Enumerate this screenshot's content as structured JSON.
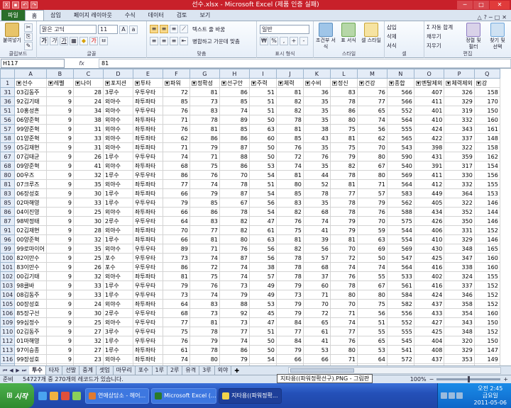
{
  "window": {
    "title": "선수.xlsx - Microsoft Excel (제품 인증 실패)",
    "min": "─",
    "max": "□",
    "close": "✕"
  },
  "ribbon_tabs": [
    "파일",
    "홈",
    "삽입",
    "페이지 레이아웃",
    "수식",
    "데이터",
    "검토",
    "보기"
  ],
  "ribbon": {
    "clipboard": {
      "paste": "붙여넣기",
      "label": "클립보드"
    },
    "font": {
      "name": "맑은 고딕",
      "size": "11",
      "label": "글꼴"
    },
    "alignment": {
      "wrap": "텍스트 줄 바꿈",
      "merge": "병합하고 가운데 맞춤",
      "label": "맞춤"
    },
    "number": {
      "format": "일반",
      "label": "표시 형식"
    },
    "styles": {
      "conditional": "조건부 서식",
      "table": "표 서식",
      "cell": "셀 스타일",
      "label": "스타일"
    },
    "cells": {
      "insert": "삽입",
      "delete": "삭제",
      "format": "서식",
      "label": "셀"
    },
    "editing": {
      "autosum": "자동 합계",
      "fill": "채우기",
      "clear": "지우기",
      "sort": "정렬 및 필터",
      "find": "찾기 및 선택",
      "label": "편집"
    }
  },
  "formula_bar": {
    "name_box": "H117",
    "fx": "fx",
    "value": "81"
  },
  "columns": [
    "A",
    "B",
    "C",
    "D",
    "E",
    "F",
    "G",
    "H",
    "I",
    "J",
    "K",
    "L",
    "M",
    "N",
    "O",
    "P",
    "Q"
  ],
  "header_row": {
    "row": "1",
    "cells": [
      "선수",
      "레벨",
      "나이",
      "포지션",
      "투타",
      "파워",
      "정확성",
      "선구안",
      "주력",
      "체력",
      "수비",
      "정신",
      "건강",
      "종합",
      "멘탈제외",
      "체력제외",
      "강"
    ]
  },
  "rows": [
    {
      "r": "31",
      "c": [
        "03김동주",
        "9",
        "28",
        "3루수",
        "우투우타",
        "72",
        "81",
        "86",
        "51",
        "81",
        "36",
        "83",
        "76",
        "566",
        "407",
        "326",
        "158"
      ]
    },
    {
      "r": "36",
      "c": [
        "92김기태",
        "9",
        "24",
        "외야수",
        "좌투좌타",
        "85",
        "73",
        "85",
        "51",
        "82",
        "35",
        "78",
        "77",
        "566",
        "411",
        "329",
        "170"
      ]
    },
    {
      "r": "51",
      "c": [
        "10홍성흔",
        "9",
        "34",
        "외야수",
        "우투우타",
        "76",
        "83",
        "74",
        "51",
        "82",
        "35",
        "86",
        "65",
        "552",
        "401",
        "319",
        "150"
      ]
    },
    {
      "r": "56",
      "c": [
        "06양준혁",
        "9",
        "38",
        "외야수",
        "좌투좌타",
        "71",
        "78",
        "89",
        "50",
        "78",
        "35",
        "80",
        "74",
        "564",
        "410",
        "332",
        "160"
      ]
    },
    {
      "r": "57",
      "c": [
        "99양준혁",
        "9",
        "31",
        "외야수",
        "좌투좌타",
        "76",
        "81",
        "85",
        "63",
        "81",
        "38",
        "75",
        "56",
        "555",
        "424",
        "343",
        "161"
      ]
    },
    {
      "r": "58",
      "c": [
        "01양준혁",
        "9",
        "33",
        "외야수",
        "좌투좌타",
        "62",
        "86",
        "86",
        "60",
        "85",
        "43",
        "81",
        "62",
        "565",
        "422",
        "337",
        "148"
      ]
    },
    {
      "r": "59",
      "c": [
        "05김재현",
        "9",
        "31",
        "외야수",
        "좌투좌타",
        "71",
        "79",
        "87",
        "50",
        "76",
        "35",
        "75",
        "70",
        "543",
        "398",
        "322",
        "158"
      ]
    },
    {
      "r": "67",
      "c": [
        "07김태균",
        "9",
        "26",
        "1루수",
        "우투우타",
        "74",
        "71",
        "88",
        "50",
        "72",
        "76",
        "79",
        "80",
        "590",
        "431",
        "359",
        "162"
      ]
    },
    {
      "r": "68",
      "c": [
        "09양준혁",
        "9",
        "41",
        "외야수",
        "좌투좌타",
        "68",
        "75",
        "86",
        "53",
        "74",
        "35",
        "82",
        "67",
        "540",
        "391",
        "317",
        "154"
      ]
    },
    {
      "r": "80",
      "c": [
        "00우즈",
        "9",
        "32",
        "1루수",
        "우투우타",
        "86",
        "76",
        "70",
        "54",
        "81",
        "44",
        "78",
        "80",
        "569",
        "411",
        "330",
        "156"
      ]
    },
    {
      "r": "81",
      "c": [
        "07크루즈",
        "9",
        "35",
        "외야수",
        "좌투좌타",
        "77",
        "74",
        "78",
        "51",
        "80",
        "52",
        "81",
        "71",
        "564",
        "412",
        "332",
        "155"
      ]
    },
    {
      "r": "83",
      "c": [
        "06장성호",
        "9",
        "30",
        "1루수",
        "좌투좌타",
        "66",
        "79",
        "87",
        "54",
        "85",
        "78",
        "77",
        "57",
        "583",
        "449",
        "364",
        "153"
      ]
    },
    {
      "r": "85",
      "c": [
        "02마해영",
        "9",
        "33",
        "1루수",
        "우투우타",
        "79",
        "85",
        "67",
        "56",
        "83",
        "35",
        "78",
        "79",
        "562",
        "405",
        "322",
        "146"
      ]
    },
    {
      "r": "86",
      "c": [
        "04이진영",
        "9",
        "25",
        "외야수",
        "좌투좌타",
        "66",
        "86",
        "78",
        "54",
        "82",
        "68",
        "78",
        "76",
        "588",
        "434",
        "352",
        "144"
      ]
    },
    {
      "r": "87",
      "c": [
        "98박정태",
        "9",
        "30",
        "2루수",
        "우투우타",
        "64",
        "83",
        "82",
        "47",
        "76",
        "74",
        "79",
        "70",
        "575",
        "426",
        "350",
        "146"
      ]
    },
    {
      "r": "91",
      "c": [
        "02김재현",
        "9",
        "28",
        "외야수",
        "좌투좌타",
        "70",
        "77",
        "82",
        "61",
        "75",
        "41",
        "79",
        "59",
        "544",
        "406",
        "331",
        "152"
      ]
    },
    {
      "r": "96",
      "c": [
        "00양준혁",
        "9",
        "32",
        "1루수",
        "좌투좌타",
        "66",
        "81",
        "80",
        "63",
        "81",
        "39",
        "81",
        "63",
        "554",
        "410",
        "329",
        "146"
      ]
    },
    {
      "r": "99",
      "c": [
        "99로마이어",
        "9",
        "35",
        "외야수",
        "우투우타",
        "89",
        "71",
        "76",
        "56",
        "82",
        "56",
        "70",
        "69",
        "569",
        "430",
        "348",
        "165"
      ]
    },
    {
      "r": "100",
      "c": [
        "82이만수",
        "9",
        "25",
        "포수",
        "우투우타",
        "73",
        "74",
        "87",
        "56",
        "78",
        "57",
        "72",
        "50",
        "547",
        "425",
        "347",
        "160"
      ]
    },
    {
      "r": "101",
      "c": [
        "83이만수",
        "9",
        "26",
        "포수",
        "우투우타",
        "86",
        "72",
        "74",
        "38",
        "78",
        "68",
        "74",
        "74",
        "564",
        "416",
        "338",
        "160"
      ]
    },
    {
      "r": "102",
      "c": [
        "00김기태",
        "9",
        "32",
        "외야수",
        "좌투좌타",
        "81",
        "75",
        "74",
        "57",
        "78",
        "37",
        "76",
        "55",
        "533",
        "402",
        "324",
        "155"
      ]
    },
    {
      "r": "103",
      "c": [
        "98클바",
        "9",
        "33",
        "1루수",
        "우투우타",
        "79",
        "76",
        "73",
        "49",
        "79",
        "60",
        "78",
        "67",
        "561",
        "416",
        "337",
        "152"
      ]
    },
    {
      "r": "104",
      "c": [
        "08김동주",
        "9",
        "33",
        "1루수",
        "우투우타",
        "73",
        "74",
        "79",
        "49",
        "73",
        "71",
        "80",
        "80",
        "584",
        "424",
        "346",
        "152"
      ]
    },
    {
      "r": "105",
      "c": [
        "00장성호",
        "9",
        "24",
        "외야수",
        "좌투좌타",
        "64",
        "83",
        "88",
        "53",
        "79",
        "70",
        "70",
        "75",
        "582",
        "437",
        "358",
        "152"
      ]
    },
    {
      "r": "106",
      "c": [
        "85장구선",
        "9",
        "30",
        "2루수",
        "우투우타",
        "68",
        "73",
        "92",
        "45",
        "79",
        "72",
        "71",
        "56",
        "556",
        "433",
        "354",
        "160"
      ]
    },
    {
      "r": "109",
      "c": [
        "99심정수",
        "9",
        "25",
        "외야수",
        "우투우타",
        "77",
        "81",
        "73",
        "47",
        "84",
        "65",
        "74",
        "51",
        "552",
        "427",
        "343",
        "150"
      ]
    },
    {
      "r": "110",
      "c": [
        "02김동주",
        "9",
        "27",
        "3루수",
        "우투우타",
        "75",
        "78",
        "77",
        "51",
        "77",
        "61",
        "77",
        "55",
        "555",
        "425",
        "348",
        "152"
      ]
    },
    {
      "r": "112",
      "c": [
        "01마해영",
        "9",
        "32",
        "1루수",
        "우투우타",
        "76",
        "79",
        "74",
        "50",
        "84",
        "41",
        "76",
        "65",
        "545",
        "404",
        "320",
        "150"
      ]
    },
    {
      "r": "113",
      "c": [
        "97이승종",
        "9",
        "27",
        "1루수",
        "좌투좌타",
        "61",
        "78",
        "86",
        "50",
        "79",
        "53",
        "80",
        "53",
        "541",
        "408",
        "329",
        "147"
      ]
    },
    {
      "r": "116",
      "c": [
        "99장성호",
        "9",
        "23",
        "외야수",
        "좌투좌타",
        "74",
        "80",
        "79",
        "54",
        "66",
        "66",
        "71",
        "64",
        "572",
        "437",
        "353",
        "149"
      ]
    },
    {
      "r": "117",
      "c": [
        "04장성호",
        "9",
        "28",
        "1루수",
        "좌투좌타",
        "69",
        "80",
        "81",
        "56",
        "78",
        "74",
        "63",
        "70",
        "570",
        "433",
        "354",
        "150"
      ]
    },
    {
      "r": "118",
      "c": [
        "03이호준",
        "9",
        "28",
        "1루수",
        "우투우타",
        "81",
        "74",
        "68",
        "51",
        "74",
        "41",
        "74",
        "74",
        "555",
        "407",
        "327",
        "156"
      ]
    }
  ],
  "sheet_tabs": [
    "투수",
    "타자",
    "선발",
    "중계",
    "셋업",
    "마무리",
    "포수",
    "1루",
    "2루",
    "유격",
    "3루",
    "외야"
  ],
  "active_sheet": "투수",
  "status": {
    "ready": "준비",
    "records": "54727개 중 270개의 레코드가 있습니다.",
    "zoom": "100%"
  },
  "tooltip": "지타용((파워정확선구).PNG - 그림판",
  "taskbar": {
    "start": "시작",
    "tasks": [
      "연애상담소 - 헤어...",
      "Microsoft Excel (...",
      "지타용((파워정확..."
    ],
    "clock_time": "오전 2:45",
    "clock_day": "금요일",
    "clock_date": "2011-05-06"
  }
}
